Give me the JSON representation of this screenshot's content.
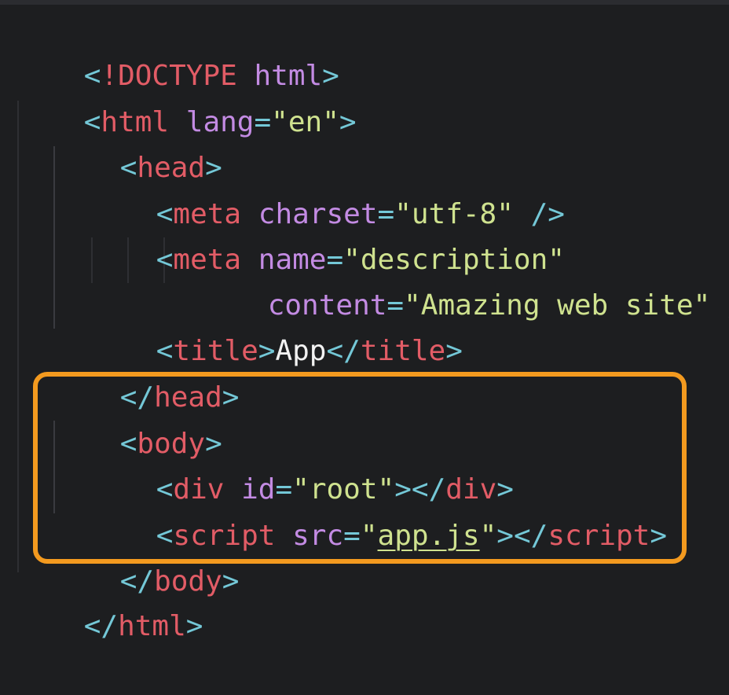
{
  "colors": {
    "background": "#1d1e20",
    "bracket": "#74c8d7",
    "tag": "#e25c66",
    "attribute": "#c38be3",
    "string": "#cfe28f",
    "text": "#f2f2f2",
    "highlight_border": "#f39a1f"
  },
  "code": {
    "l1": {
      "open": "<",
      "tag": "!DOCTYPE",
      "sp": " ",
      "attr": "html",
      "close": ">"
    },
    "l2": {
      "open": "<",
      "tag": "html",
      "sp": " ",
      "attr": "lang",
      "eq": "=",
      "val": "\"en\"",
      "close": ">"
    },
    "l3": {
      "open": "<",
      "tag": "head",
      "close": ">"
    },
    "l4": {
      "open": "<",
      "tag": "meta",
      "sp": " ",
      "attr": "charset",
      "eq": "=",
      "val": "\"utf-8\"",
      "sp2": " ",
      "close": "/>"
    },
    "l5": {
      "open": "<",
      "tag": "meta",
      "sp": " ",
      "attr": "name",
      "eq": "=",
      "val": "\"description\""
    },
    "l6": {
      "attr": "content",
      "eq": "=",
      "val": "\"Amazing web site\"",
      "sp": " ",
      "close": "/>"
    },
    "l7": {
      "open": "<",
      "tag": "title",
      "close": ">",
      "text": "App",
      "open2": "</",
      "tag2": "title",
      "close2": ">"
    },
    "l8": {
      "open": "</",
      "tag": "head",
      "close": ">"
    },
    "l9": {
      "open": "<",
      "tag": "body",
      "close": ">"
    },
    "l10": {
      "open": "<",
      "tag": "div",
      "sp": " ",
      "attr": "id",
      "eq": "=",
      "val": "\"root\"",
      "close": ">",
      "open2": "</",
      "tag2": "div",
      "close2": ">"
    },
    "l11": {
      "open": "<",
      "tag": "script",
      "sp": " ",
      "attr": "src",
      "eq": "=",
      "q1": "\"",
      "link": "app.js",
      "q2": "\"",
      "close": ">",
      "open2": "</",
      "tag2": "script",
      "close2": ">"
    },
    "l12": {
      "open": "</",
      "tag": "body",
      "close": ">"
    },
    "l13": {
      "open": "</",
      "tag": "html",
      "close": ">"
    }
  }
}
